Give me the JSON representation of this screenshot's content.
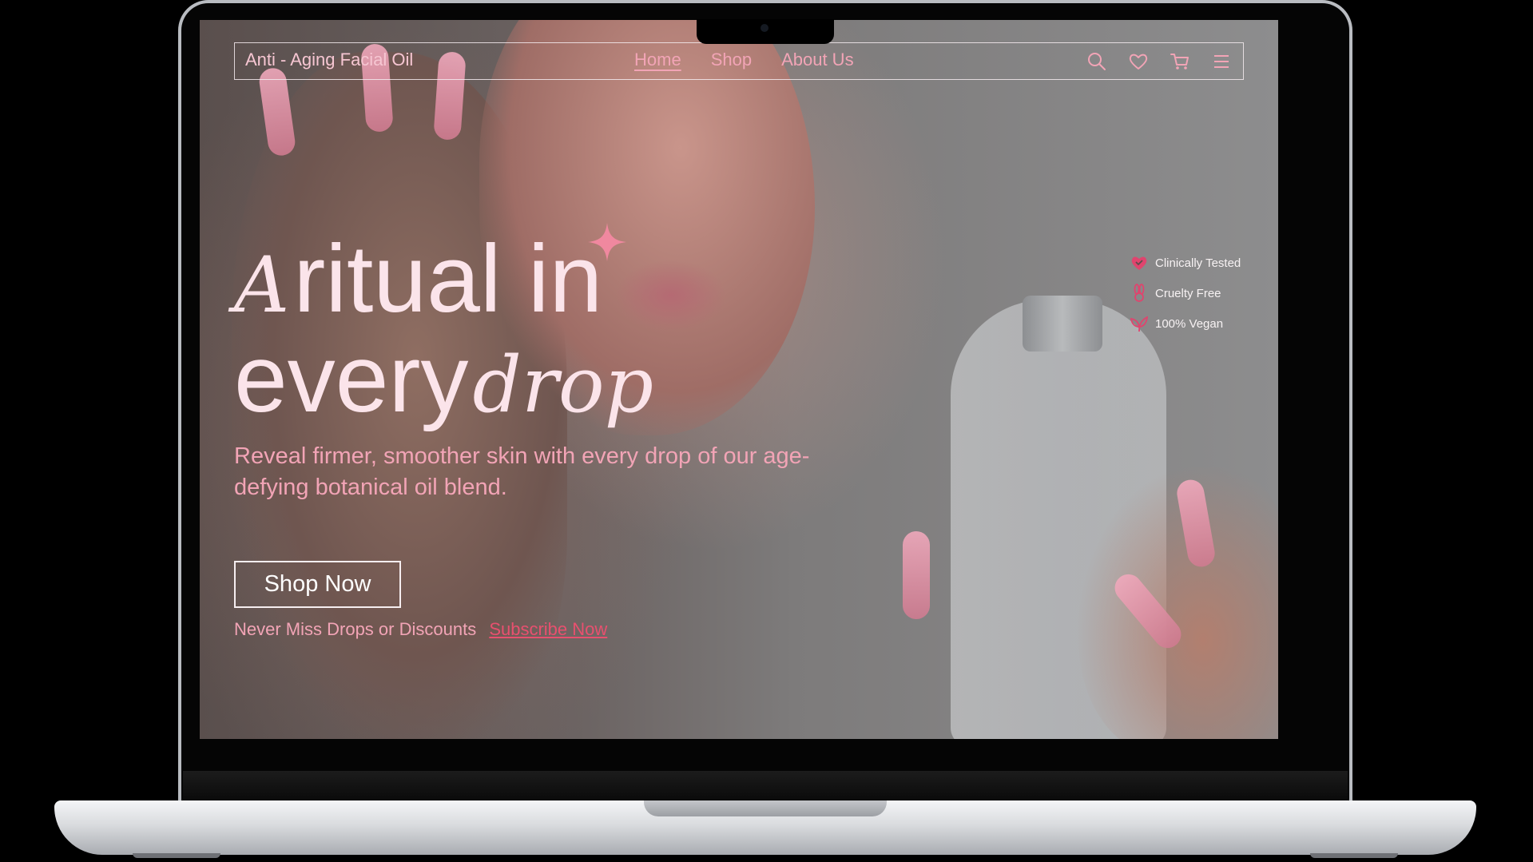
{
  "brand": "Anti - Aging Facial Oil",
  "nav": {
    "links": [
      {
        "label": "Home",
        "active": true
      },
      {
        "label": "Shop",
        "active": false
      },
      {
        "label": "About Us",
        "active": false
      }
    ],
    "icons": [
      "search-icon",
      "heart-icon",
      "cart-icon",
      "menu-icon"
    ]
  },
  "hero": {
    "line1_script": "A",
    "line1_word": "ritual in",
    "line2_word": "every",
    "line2_script": "drop",
    "subtitle": "Reveal firmer, smoother skin with every drop of our age-defying botanical oil blend.",
    "cta_label": "Shop Now",
    "promo_text": "Never Miss Drops or Discounts",
    "promo_link": "Subscribe Now"
  },
  "badges": [
    {
      "icon": "heart-check-icon",
      "label": "Clinically Tested"
    },
    {
      "icon": "bunny-icon",
      "label": "Cruelty Free"
    },
    {
      "icon": "leaf-icon",
      "label": "100% Vegan"
    }
  ],
  "colors": {
    "accent_pink": "#f2a4b6",
    "link_pink": "#e8506f",
    "badge_icon": "#e0446e",
    "hero_text": "#fbe4ea"
  }
}
